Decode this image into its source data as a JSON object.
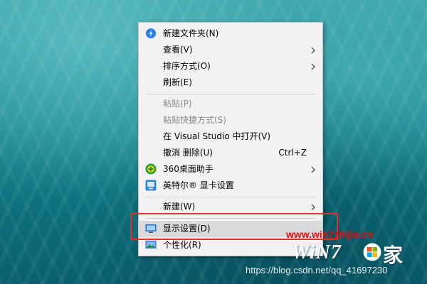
{
  "context_menu": {
    "items": [
      {
        "label": "新建文件夹(N)",
        "icon": "baidu-netdisk-icon"
      },
      {
        "label": "查看(V)",
        "submenu": true
      },
      {
        "label": "排序方式(O)",
        "submenu": true
      },
      {
        "label": "刷新(E)"
      },
      {
        "label": "粘贴(P)",
        "disabled": true
      },
      {
        "label": "粘贴快捷方式(S)",
        "disabled": true
      },
      {
        "label": "在 Visual Studio 中打开(V)"
      },
      {
        "label": "撤消 删除(U)",
        "shortcut": "Ctrl+Z"
      },
      {
        "label": "360桌面助手",
        "icon": "360-desktop-icon",
        "submenu": true
      },
      {
        "label": "英特尔® 显卡设置",
        "icon": "intel-graphics-icon"
      },
      {
        "label": "新建(W)",
        "submenu": true
      },
      {
        "label": "显示设置(D)",
        "icon": "display-settings-icon",
        "highlighted": true
      },
      {
        "label": "个性化(R)",
        "icon": "personalize-icon"
      }
    ]
  },
  "highlight_box_color": "#e03030",
  "overlay": {
    "site_url": "www.win7zhijia.cn",
    "logo_text": "WiN7",
    "logo_char": "家",
    "watermark": "https://blog.csdn.net/qq_41697230"
  },
  "colors": {
    "menu_background": "#f2f2f2",
    "highlight_background": "#dadada",
    "disabled_text": "#8a8a8a",
    "url_text": "#e01010"
  }
}
